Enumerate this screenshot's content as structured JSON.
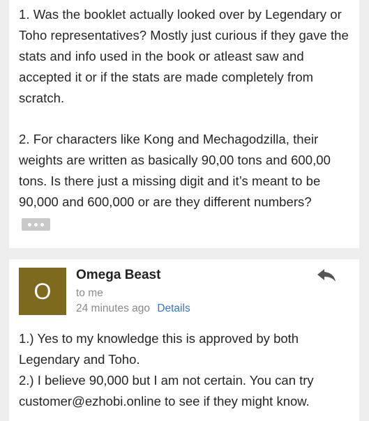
{
  "quoted_message": {
    "question_1": "1. Was the booklet actually looked over by Legendary or Toho representatives? Mostly just curious if they gave the stats and info used in the book or atleast saw and accepted it or if the stats are made completely from scratch.",
    "question_2": "2. For characters like Kong and Mechagodzilla, their weights are written as basically 90,00 tons and 600,00 tons. Is there just a missing digit and it’s meant to be 90,000 and 600,000 or are they different numbers?",
    "show_trimmed_icon": "ellipsis-icon"
  },
  "reply": {
    "avatar_letter": "O",
    "avatar_color": "#7e6a1f",
    "sender_name": "Omega Beast",
    "recipient": "to me",
    "time": "24 minutes ago",
    "details_label": "Details",
    "reply_icon": "reply-icon",
    "body_lines": [
      "1.) Yes to my knowledge this is approved by both Legendary and Toho.",
      "2.) I believe 90,000 but I am not certain. You can try customer@ezhobi.online to see if they might know."
    ]
  },
  "colors": {
    "background": "#eeeeee",
    "card": "#ffffff",
    "link": "#3b73c4",
    "muted": "#8a8a8a"
  }
}
